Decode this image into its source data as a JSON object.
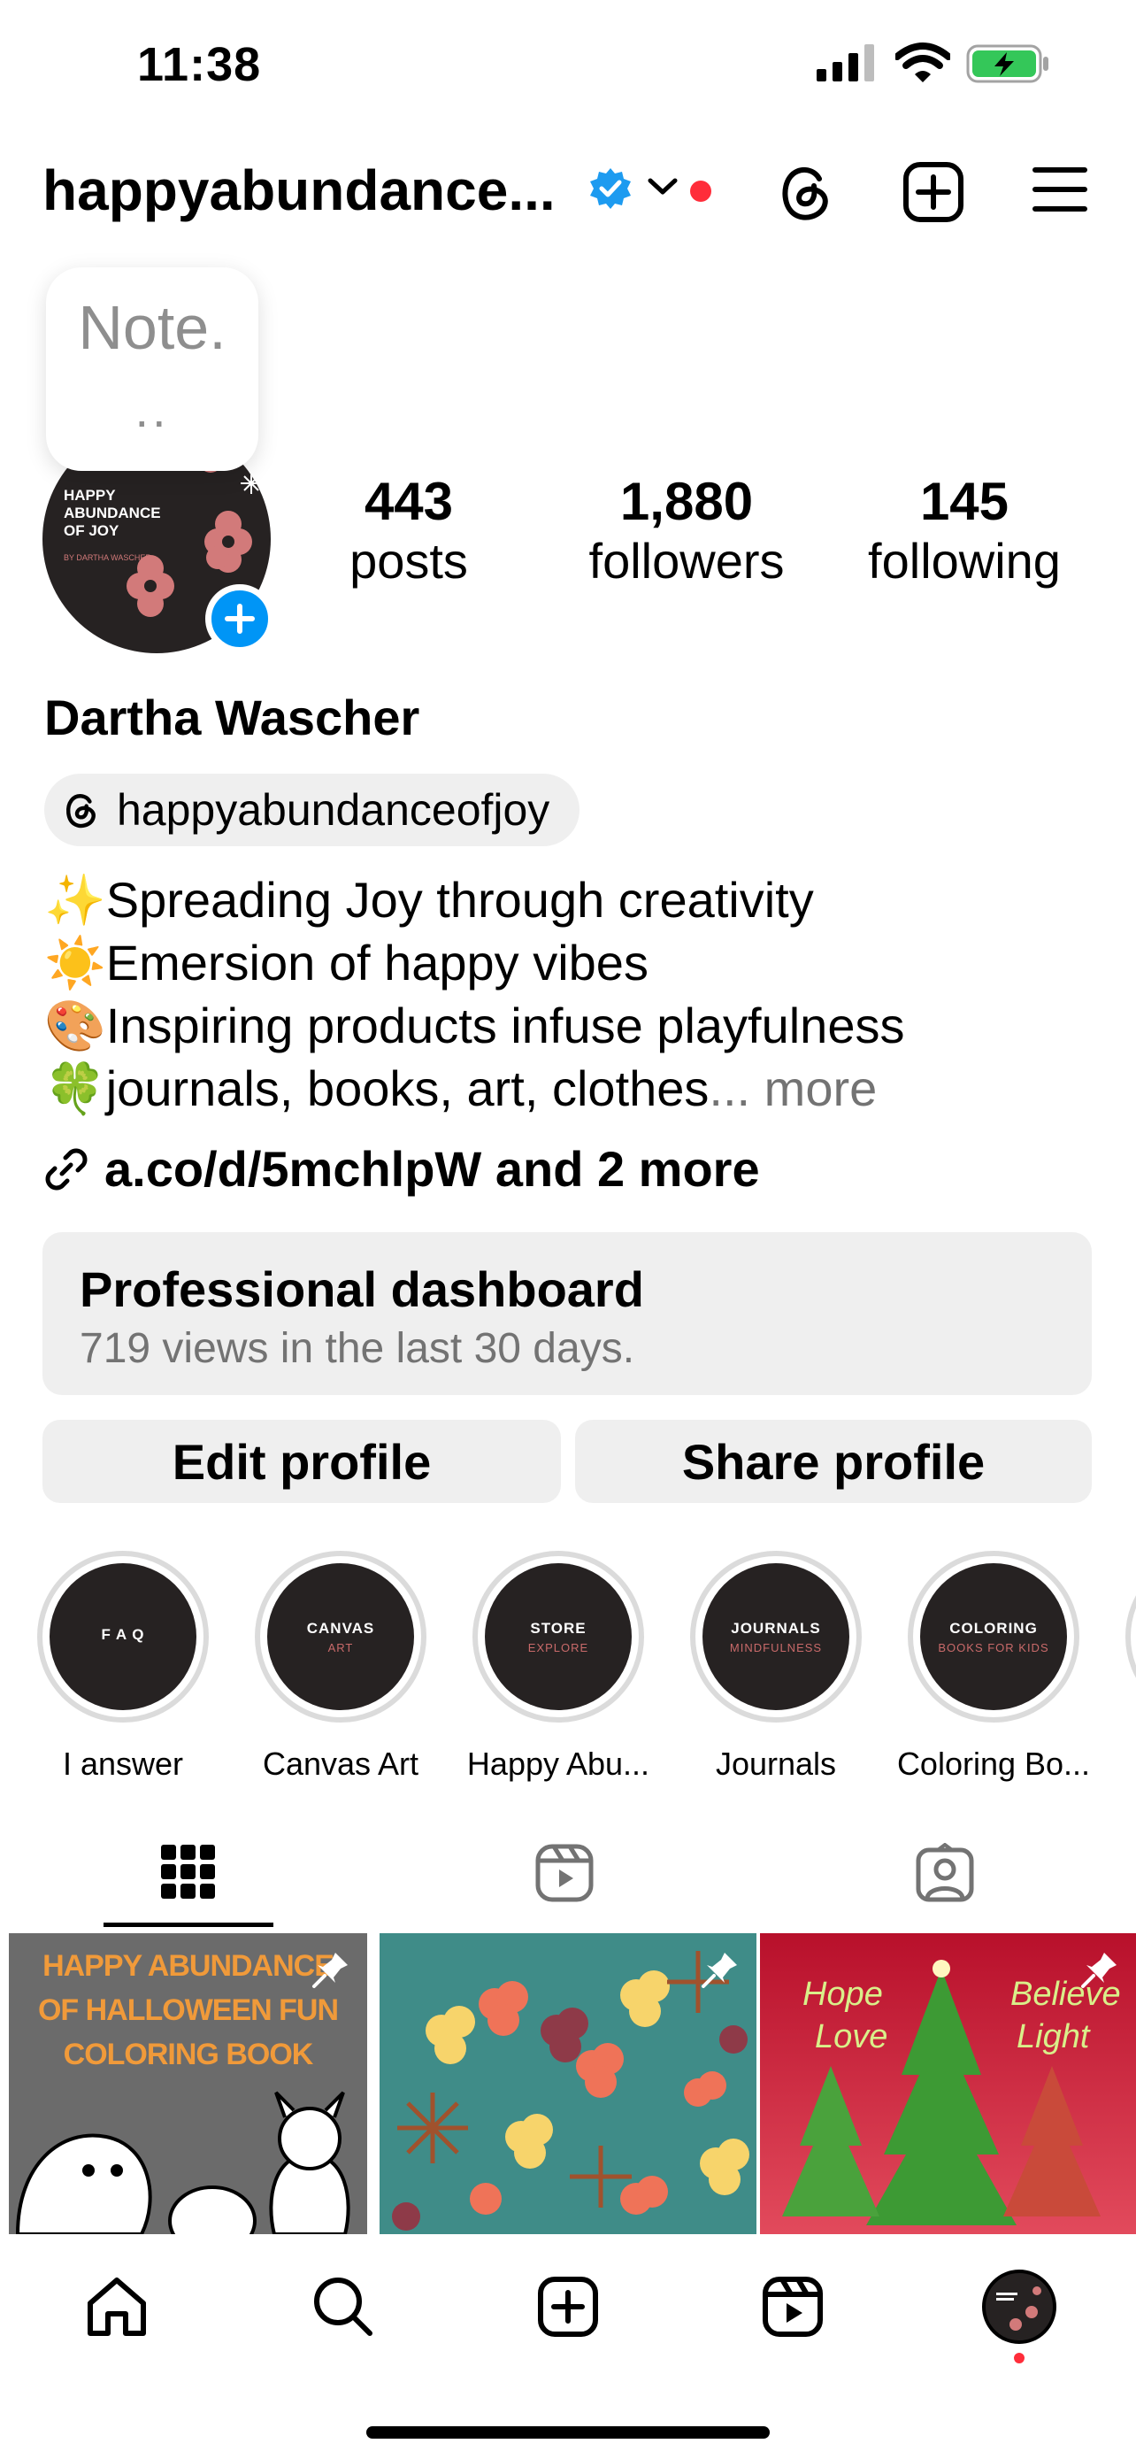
{
  "status_bar": {
    "time": "11:38"
  },
  "header": {
    "username": "happyabundance..."
  },
  "note": {
    "text": "Note.",
    "dots": ".."
  },
  "avatar": {
    "line1": "HAPPY",
    "line2": "ABUNDANCE",
    "line3": "OF JOY",
    "byline": "BY DARTHA WASCHER"
  },
  "stats": {
    "posts_count": "443",
    "posts_label": "posts",
    "followers_count": "1,880",
    "followers_label": "followers",
    "following_count": "145",
    "following_label": "following"
  },
  "profile": {
    "full_name": "Dartha Wascher",
    "threads_handle": "happyabundanceofjoy",
    "bio": [
      {
        "emoji": "✨",
        "text": "Spreading Joy through creativity"
      },
      {
        "emoji": "☀️",
        "text": "Emersion of happy vibes"
      },
      {
        "emoji": "🎨",
        "text": "Inspiring products infuse playfulness"
      },
      {
        "emoji": "🍀",
        "text": "journals, books, art, clothes"
      }
    ],
    "bio_ellipsis": "...",
    "bio_more": "more",
    "link_text": "a.co/d/5mchlpW and 2 more"
  },
  "dashboard": {
    "title": "Professional dashboard",
    "subtitle": "719 views in the last 30 days."
  },
  "buttons": {
    "edit": "Edit profile",
    "share": "Share profile"
  },
  "highlights": [
    {
      "top": "F A Q",
      "bottom": "",
      "label": "I answer"
    },
    {
      "top": "CANVAS",
      "bottom": "ART",
      "label": "Canvas Art"
    },
    {
      "top": "STORE",
      "bottom": "EXPLORE",
      "label": "Happy Abu..."
    },
    {
      "top": "JOURNALS",
      "bottom": "MINDFULNESS",
      "label": "Journals"
    },
    {
      "top": "COLORING",
      "bottom": "BOOKS FOR KIDS",
      "label": "Coloring Bo..."
    }
  ],
  "grid": {
    "post1_title_l1": "HAPPY ABUNDANCE",
    "post1_title_l2": "OF HALLOWEEN FUN",
    "post1_title_l3": "COLORING BOOK",
    "post3_words": [
      "Hope",
      "Believe",
      "Love",
      "Light"
    ]
  },
  "colors": {
    "accent_blue": "#0095f6",
    "notification_red": "#ff2d3a",
    "button_gray": "#efefef",
    "battery_green": "#34c759"
  }
}
